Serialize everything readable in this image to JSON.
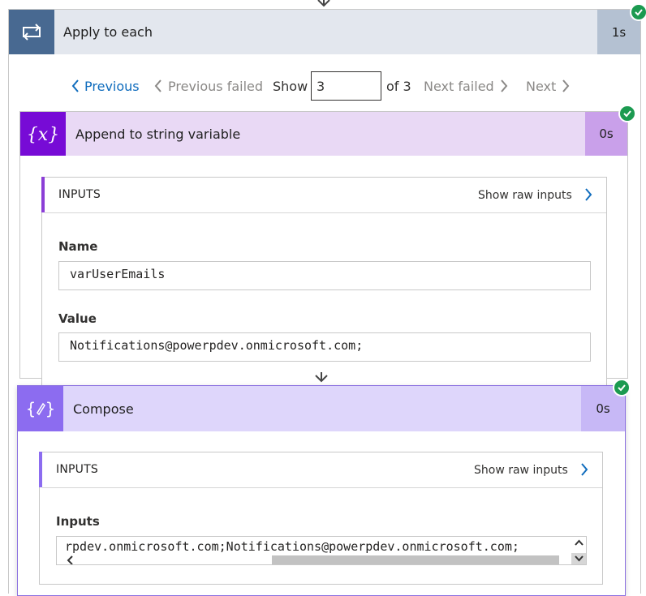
{
  "apply_to_each": {
    "title": "Apply to each",
    "duration": "1s",
    "status_icon": "check-circle-icon",
    "icon": "loop-icon",
    "header_color": "#486991"
  },
  "pager": {
    "previous_label": "Previous",
    "previous_failed_label": "Previous failed",
    "show_label": "Show",
    "current_value": "3",
    "of_label": "of 3",
    "next_failed_label": "Next failed",
    "next_label": "Next"
  },
  "append_action": {
    "title": "Append to string variable",
    "duration": "0s",
    "icon": "variable-icon",
    "accent_color": "#770bd6",
    "inputs_title": "INPUTS",
    "show_raw_label": "Show raw inputs",
    "fields": [
      {
        "label": "Name",
        "value": "varUserEmails"
      },
      {
        "label": "Value",
        "value": "Notifications@powerpdev.onmicrosoft.com;"
      }
    ]
  },
  "compose_action": {
    "title": "Compose",
    "duration": "0s",
    "icon": "compose-icon",
    "accent_color": "#8c6cf0",
    "inputs_title": "INPUTS",
    "show_raw_label": "Show raw inputs",
    "field_label": "Inputs",
    "field_value": "rpdev.onmicrosoft.com;Notifications@powerpdev.onmicrosoft.com;"
  }
}
